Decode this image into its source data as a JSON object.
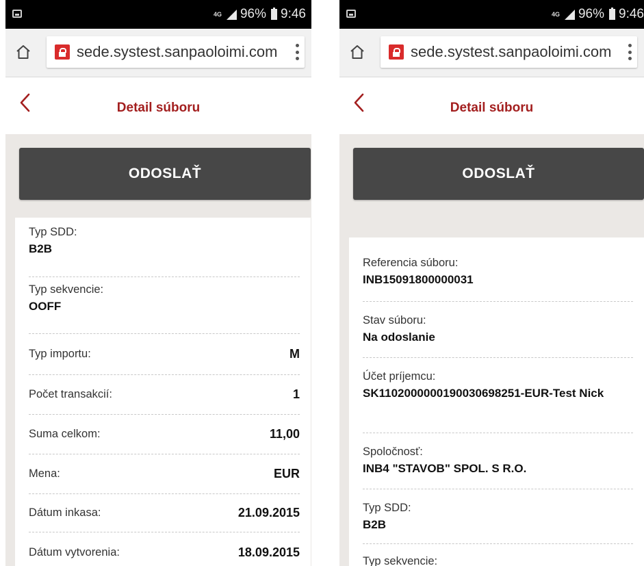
{
  "status_bar": {
    "network": "4G",
    "battery": "96%",
    "time": "9:46"
  },
  "browser": {
    "url": "sede.systest.sanpaoloimi.com"
  },
  "header": {
    "title": "Detail súboru"
  },
  "actions": {
    "send_label": "ODOSLAŤ"
  },
  "left_screen": {
    "rows": [
      {
        "label": "Typ SDD:",
        "value": "B2B"
      },
      {
        "label": "Typ sekvencie:",
        "value": "OOFF"
      },
      {
        "label": "Typ importu:",
        "value": "M"
      },
      {
        "label": "Počet transakcií:",
        "value": "1"
      },
      {
        "label": "Suma celkom:",
        "value": "11,00"
      },
      {
        "label": "Mena:",
        "value": "EUR"
      },
      {
        "label": "Dátum inkasa:",
        "value": "21.09.2015"
      },
      {
        "label": "Dátum vytvorenia:",
        "value": "18.09.2015"
      }
    ]
  },
  "right_screen": {
    "rows": [
      {
        "label": "Referencia súboru:",
        "value": "INB15091800000031"
      },
      {
        "label": "Stav súboru:",
        "value": "Na odoslanie"
      },
      {
        "label": "Účet príjemcu:",
        "value": "SK1102000000190030698251-EUR-Test Nick"
      },
      {
        "label": "Spoločnosť:",
        "value": "INB4 \"STAVOB\" SPOL. S R.O."
      },
      {
        "label": "Typ SDD:",
        "value": "B2B"
      },
      {
        "label": "Typ sekvencie:",
        "value": ""
      }
    ]
  },
  "colors": {
    "accent": "#a31f1f",
    "button": "#474747",
    "background": "#ebe8e5"
  }
}
